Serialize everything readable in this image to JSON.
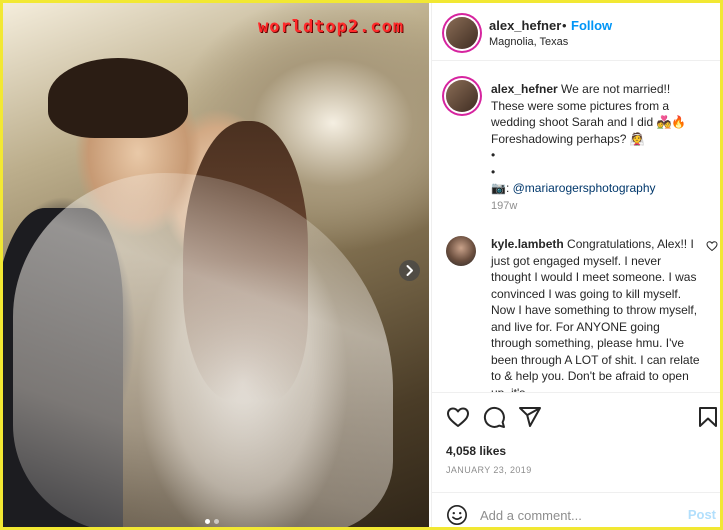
{
  "watermark": "worldtop2.com",
  "photo": {
    "next_icon": "chevron-right-icon",
    "carousel_total": 2,
    "carousel_active": 1
  },
  "header": {
    "username": "alex_hefner",
    "separator": "•",
    "follow_label": "Follow",
    "location": "Magnolia, Texas",
    "more_icon": "more-options-icon"
  },
  "caption": {
    "username": "alex_hefner",
    "lines": [
      "We are not married!!",
      "These were some pictures from a",
      "wedding shoot Sarah and I did 💑🔥",
      "Foreshadowing perhaps? 👰",
      "•",
      "•"
    ],
    "credit_prefix": "📷: ",
    "credit_handle": "@mariarogersphotography",
    "age": "197w"
  },
  "comment": {
    "username": "kyle.lambeth",
    "text": "Congratulations, Alex!! I just got engaged myself. I never thought I would I meet someone. I was convinced I was going to kill myself. Now I have something to throw myself, and live for. For ANYONE going through something, please hmu. I've been through A LOT of shit. I can relate to & help you. Don't be afraid to open up, it's",
    "like_icon": "heart-outline-icon"
  },
  "actions": {
    "icons": [
      "heart-icon",
      "comment-icon",
      "share-icon",
      "bookmark-icon"
    ],
    "likes": "4,058 likes",
    "date": "JANUARY 23, 2019"
  },
  "comment_box": {
    "emoji_icon": "smiley-icon",
    "placeholder": "Add a comment...",
    "post_label": "Post"
  },
  "colors": {
    "accent": "#0095f6",
    "link": "#00376b",
    "muted": "#8e8e8e",
    "post_disabled": "#b2dffc",
    "frame": "#f2e833",
    "watermark": "#ff2a2a"
  }
}
